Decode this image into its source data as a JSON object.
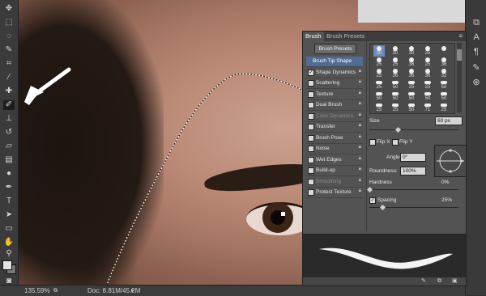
{
  "status": {
    "zoom": "135.59%",
    "doc": "Doc: 8.81M/45.2M"
  },
  "panel": {
    "tabs": [
      "Brush",
      "Brush Presets"
    ],
    "presets_button": "Brush Presets",
    "options": [
      {
        "label": "Brush Tip Shape",
        "checked": null,
        "locked": false,
        "dim": false,
        "tip": true
      },
      {
        "label": "Shape Dynamics",
        "checked": true,
        "locked": true,
        "dim": false
      },
      {
        "label": "Scattering",
        "checked": false,
        "locked": true,
        "dim": false
      },
      {
        "label": "Texture",
        "checked": false,
        "locked": true,
        "dim": false
      },
      {
        "label": "Dual Brush",
        "checked": false,
        "locked": true,
        "dim": false
      },
      {
        "label": "Color Dynamics",
        "checked": false,
        "locked": true,
        "dim": true
      },
      {
        "label": "Transfer",
        "checked": false,
        "locked": true,
        "dim": false
      },
      {
        "label": "Brush Pose",
        "checked": false,
        "locked": true,
        "dim": false
      },
      {
        "label": "Noise",
        "checked": false,
        "locked": true,
        "dim": false
      },
      {
        "label": "Wet Edges",
        "checked": false,
        "locked": true,
        "dim": false
      },
      {
        "label": "Build-up",
        "checked": false,
        "locked": true,
        "dim": false
      },
      {
        "label": "Smoothing",
        "checked": false,
        "locked": true,
        "dim": true
      },
      {
        "label": "Protect Texture",
        "checked": false,
        "locked": true,
        "dim": false
      }
    ],
    "brush_sizes": [
      [
        "30",
        "30",
        "30",
        "25",
        ""
      ],
      [
        "25",
        "25",
        "36",
        "25",
        "36"
      ],
      [
        "25",
        "36",
        "36",
        "36",
        "32"
      ],
      [
        "25",
        "50",
        "25",
        "25",
        "50"
      ],
      [
        "50",
        "50",
        "50",
        "50",
        "50"
      ],
      [
        "25",
        "25",
        "50",
        "71",
        "25"
      ]
    ],
    "size_label": "Size",
    "size_value": "60 px",
    "flip_x": "Flip X",
    "flip_y": "Flip Y",
    "angle_label": "Angle:",
    "angle_value": "0°",
    "roundness_label": "Roundness:",
    "roundness_value": "100%",
    "hardness_label": "Hardness",
    "hardness_value": "0%",
    "spacing_label": "Spacing",
    "spacing_value": "25%"
  },
  "colors": {
    "foreground": "#e4e4e4",
    "background": "#777777",
    "selected_option": "#4f6d94"
  }
}
